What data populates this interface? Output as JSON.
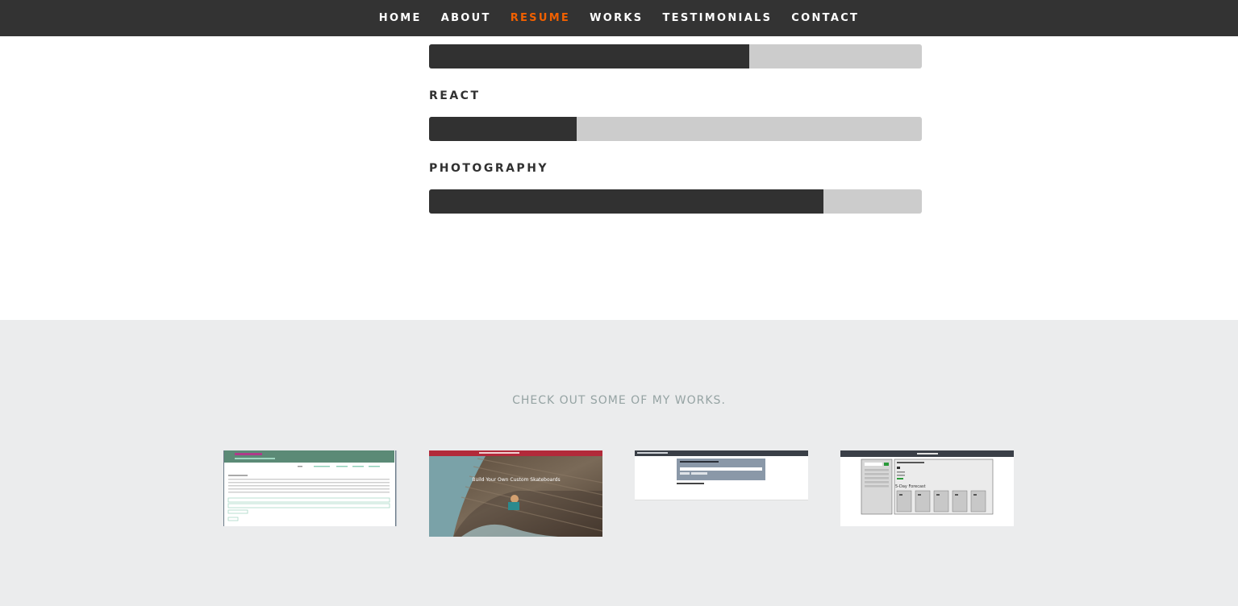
{
  "nav": {
    "items": [
      {
        "label": "HOME"
      },
      {
        "label": "ABOUT"
      },
      {
        "label": "RESUME",
        "active": true
      },
      {
        "label": "WORKS"
      },
      {
        "label": "TESTIMONIALS"
      },
      {
        "label": "CONTACT"
      }
    ],
    "active_color": "#f06000"
  },
  "skills": [
    {
      "label": "",
      "level": 0.65
    },
    {
      "label": "REACT",
      "level": 0.3
    },
    {
      "label": "PHOTOGRAPHY",
      "level": 0.8
    }
  ],
  "works": {
    "title": "CHECK OUT SOME OF MY WORKS.",
    "items": [
      {
        "name": "welcome-to-my-site",
        "header_color": "#5b8a76"
      },
      {
        "name": "custom-skateboards",
        "header_color": "#b22a3a",
        "caption": "Build Your Own Custom Skateboards"
      },
      {
        "name": "random-password-generator",
        "header_color": "#3a3f47"
      },
      {
        "name": "weather-dashboard",
        "header_color": "#3a3f47",
        "caption": "5-Day Forecast"
      }
    ]
  },
  "colors": {
    "nav_bg": "#333333",
    "bar_fill": "#313131",
    "bar_track": "#cccccc",
    "works_bg": "#ebeced"
  }
}
